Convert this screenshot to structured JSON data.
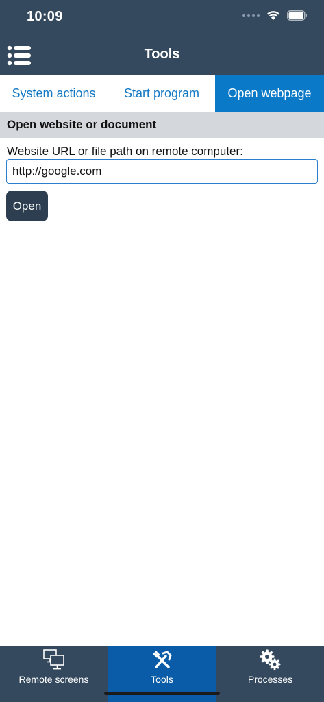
{
  "status_bar": {
    "time": "10:09"
  },
  "nav": {
    "title": "Tools",
    "menu_icon": "list-menu-icon"
  },
  "tabs": [
    {
      "label": "System actions",
      "selected": false
    },
    {
      "label": "Start program",
      "selected": false
    },
    {
      "label": "Open webpage",
      "selected": true
    }
  ],
  "section": {
    "title": "Open website or document"
  },
  "form": {
    "url_label": "Website URL or file path on remote computer:",
    "url_value": "http://google.com",
    "open_button": "Open"
  },
  "bottom_tabs": [
    {
      "label": "Remote screens",
      "icon": "monitors-icon",
      "selected": false
    },
    {
      "label": "Tools",
      "icon": "tools-icon",
      "selected": true
    },
    {
      "label": "Processes",
      "icon": "gears-icon",
      "selected": false
    }
  ],
  "colors": {
    "header_bg": "#34495e",
    "accent_blue": "#0a79c8",
    "selected_bottom_tab": "#0a5ba8",
    "section_bg": "#d4d8dc",
    "button_bg": "#2c3e50"
  }
}
